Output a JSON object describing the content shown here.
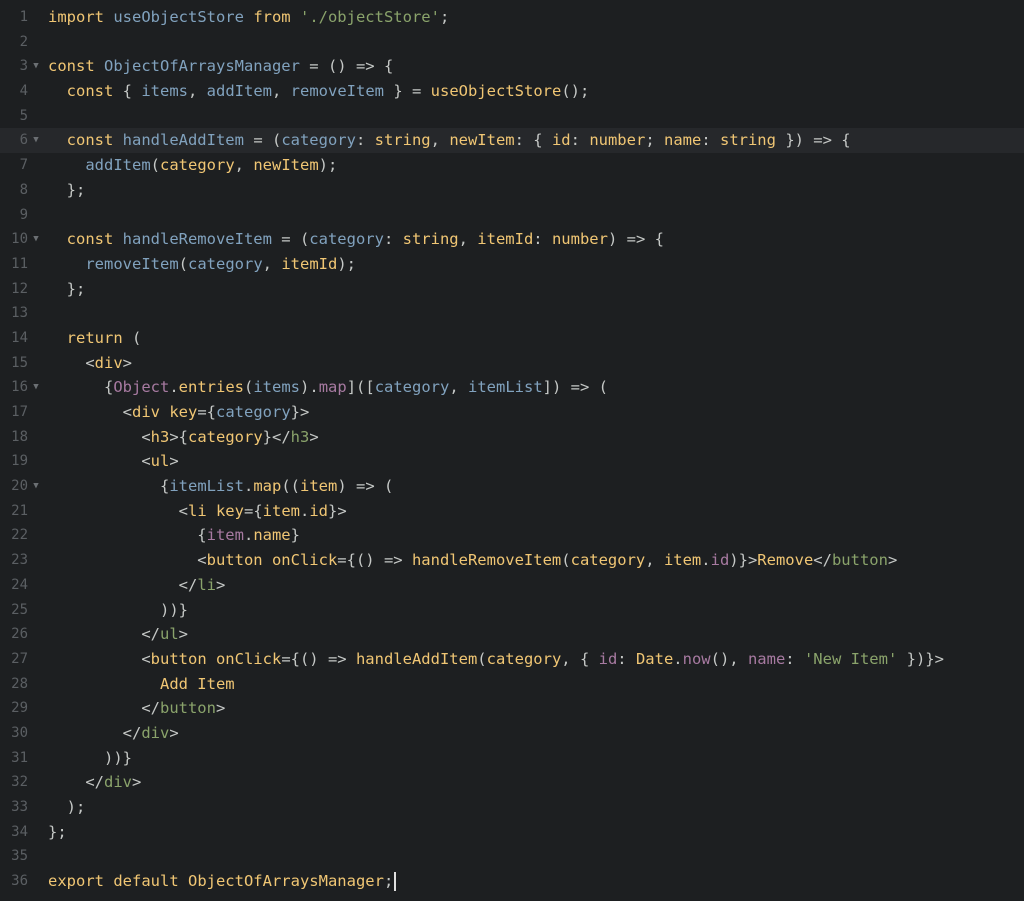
{
  "editor": {
    "lines": [
      {
        "n": "1",
        "fold": false,
        "t": [
          [
            "kw",
            "import "
          ],
          [
            "fn",
            "useObjectStore"
          ],
          [
            "kw",
            " from "
          ],
          [
            "gr",
            "'./objectStore'"
          ],
          [
            "wh",
            ";"
          ]
        ]
      },
      {
        "n": "2",
        "fold": false,
        "t": []
      },
      {
        "n": "3",
        "fold": true,
        "t": [
          [
            "kw",
            "const "
          ],
          [
            "fn",
            "ObjectOfArraysManager"
          ],
          [
            "wh",
            " = () => {"
          ]
        ]
      },
      {
        "n": "4",
        "fold": false,
        "t": [
          [
            "kw",
            "  const "
          ],
          [
            "wh",
            "{ "
          ],
          [
            "fn",
            "items"
          ],
          [
            "wh",
            ", "
          ],
          [
            "fn",
            "addItem"
          ],
          [
            "wh",
            ", "
          ],
          [
            "fn",
            "removeItem"
          ],
          [
            "wh",
            " } = "
          ],
          [
            "kw",
            "useObjectStore"
          ],
          [
            "wh",
            "();"
          ]
        ]
      },
      {
        "n": "5",
        "fold": false,
        "t": []
      },
      {
        "n": "6",
        "fold": true,
        "active": true,
        "t": [
          [
            "kw",
            "  const "
          ],
          [
            "fn",
            "handleAddItem"
          ],
          [
            "wh",
            " = ("
          ],
          [
            "fn",
            "category"
          ],
          [
            "wh",
            ": "
          ],
          [
            "kw",
            "string"
          ],
          [
            "wh",
            ", "
          ],
          [
            "kw",
            "newItem"
          ],
          [
            "wh",
            ": { "
          ],
          [
            "kw",
            "id"
          ],
          [
            "wh",
            ": "
          ],
          [
            "kw",
            "number"
          ],
          [
            "wh",
            "; "
          ],
          [
            "kw",
            "name"
          ],
          [
            "wh",
            ": "
          ],
          [
            "kw",
            "string"
          ],
          [
            "wh",
            " }) => {"
          ]
        ]
      },
      {
        "n": "7",
        "fold": false,
        "t": [
          [
            "fn",
            "    addItem"
          ],
          [
            "wh",
            "("
          ],
          [
            "kw",
            "category"
          ],
          [
            "wh",
            ", "
          ],
          [
            "kw",
            "newItem"
          ],
          [
            "wh",
            ");"
          ]
        ]
      },
      {
        "n": "8",
        "fold": false,
        "t": [
          [
            "wh",
            "  };"
          ]
        ]
      },
      {
        "n": "9",
        "fold": false,
        "t": []
      },
      {
        "n": "10",
        "fold": true,
        "t": [
          [
            "kw",
            "  const "
          ],
          [
            "fn",
            "handleRemoveItem"
          ],
          [
            "wh",
            " = ("
          ],
          [
            "fn",
            "category"
          ],
          [
            "wh",
            ": "
          ],
          [
            "kw",
            "string"
          ],
          [
            "wh",
            ", "
          ],
          [
            "kw",
            "itemId"
          ],
          [
            "wh",
            ": "
          ],
          [
            "kw",
            "number"
          ],
          [
            "wh",
            ") => {"
          ]
        ]
      },
      {
        "n": "11",
        "fold": false,
        "t": [
          [
            "fn",
            "    removeItem"
          ],
          [
            "wh",
            "("
          ],
          [
            "fn",
            "category"
          ],
          [
            "wh",
            ", "
          ],
          [
            "kw",
            "itemId"
          ],
          [
            "wh",
            ");"
          ]
        ]
      },
      {
        "n": "12",
        "fold": false,
        "t": [
          [
            "wh",
            "  };"
          ]
        ]
      },
      {
        "n": "13",
        "fold": false,
        "t": []
      },
      {
        "n": "14",
        "fold": false,
        "t": [
          [
            "kw",
            "  return "
          ],
          [
            "wh",
            "("
          ]
        ]
      },
      {
        "n": "15",
        "fold": false,
        "t": [
          [
            "wh",
            "    <"
          ],
          [
            "kw",
            "div"
          ],
          [
            "wh",
            ">"
          ]
        ]
      },
      {
        "n": "16",
        "fold": true,
        "t": [
          [
            "wh",
            "      {"
          ],
          [
            "pu",
            "Object"
          ],
          [
            "wh",
            "."
          ],
          [
            "kw",
            "entries"
          ],
          [
            "wh",
            "("
          ],
          [
            "fn",
            "items"
          ],
          [
            "wh",
            ")."
          ],
          [
            "pu",
            "map"
          ],
          [
            "wh",
            "](["
          ],
          [
            "fn",
            "category"
          ],
          [
            "wh",
            ", "
          ],
          [
            "fn",
            "itemList"
          ],
          [
            "wh",
            "]) => ("
          ]
        ]
      },
      {
        "n": "17",
        "fold": false,
        "t": [
          [
            "wh",
            "        <"
          ],
          [
            "kw",
            "div key"
          ],
          [
            "wh",
            "={"
          ],
          [
            "fn",
            "category"
          ],
          [
            "wh",
            "}>"
          ]
        ]
      },
      {
        "n": "18",
        "fold": false,
        "t": [
          [
            "wh",
            "          <"
          ],
          [
            "kw",
            "h3"
          ],
          [
            "wh",
            ">{"
          ],
          [
            "kw",
            "category"
          ],
          [
            "wh",
            "}</"
          ],
          [
            "gr",
            "h3"
          ],
          [
            "wh",
            ">"
          ]
        ]
      },
      {
        "n": "19",
        "fold": false,
        "t": [
          [
            "wh",
            "          <"
          ],
          [
            "kw",
            "ul"
          ],
          [
            "wh",
            ">"
          ]
        ]
      },
      {
        "n": "20",
        "fold": true,
        "t": [
          [
            "wh",
            "            {"
          ],
          [
            "fn",
            "itemList"
          ],
          [
            "wh",
            "."
          ],
          [
            "kw",
            "map"
          ],
          [
            "wh",
            "(("
          ],
          [
            "kw",
            "item"
          ],
          [
            "wh",
            ") => ("
          ]
        ]
      },
      {
        "n": "21",
        "fold": false,
        "t": [
          [
            "wh",
            "              <"
          ],
          [
            "kw",
            "li key"
          ],
          [
            "wh",
            "={"
          ],
          [
            "kw",
            "item"
          ],
          [
            "wh",
            "."
          ],
          [
            "kw",
            "id"
          ],
          [
            "wh",
            "}>"
          ]
        ]
      },
      {
        "n": "22",
        "fold": false,
        "t": [
          [
            "wh",
            "                {"
          ],
          [
            "pu",
            "item"
          ],
          [
            "wh",
            "."
          ],
          [
            "kw",
            "name"
          ],
          [
            "wh",
            "}"
          ]
        ]
      },
      {
        "n": "23",
        "fold": false,
        "t": [
          [
            "wh",
            "                <"
          ],
          [
            "kw",
            "button onClick"
          ],
          [
            "wh",
            "={() => "
          ],
          [
            "kw",
            "handleRemoveItem"
          ],
          [
            "wh",
            "("
          ],
          [
            "kw",
            "category"
          ],
          [
            "wh",
            ", "
          ],
          [
            "kw",
            "item"
          ],
          [
            "wh",
            "."
          ],
          [
            "pu",
            "id"
          ],
          [
            "wh",
            ")}>"
          ],
          [
            "kw",
            "Remove"
          ],
          [
            "wh",
            "</"
          ],
          [
            "gr",
            "button"
          ],
          [
            "wh",
            ">"
          ]
        ]
      },
      {
        "n": "24",
        "fold": false,
        "t": [
          [
            "wh",
            "              </"
          ],
          [
            "gr",
            "li"
          ],
          [
            "wh",
            ">"
          ]
        ]
      },
      {
        "n": "25",
        "fold": false,
        "t": [
          [
            "wh",
            "            ))}"
          ]
        ]
      },
      {
        "n": "26",
        "fold": false,
        "t": [
          [
            "wh",
            "          </"
          ],
          [
            "gr",
            "ul"
          ],
          [
            "wh",
            ">"
          ]
        ]
      },
      {
        "n": "27",
        "fold": false,
        "t": [
          [
            "wh",
            "          <"
          ],
          [
            "kw",
            "button onClick"
          ],
          [
            "wh",
            "={() => "
          ],
          [
            "kw",
            "handleAddItem"
          ],
          [
            "wh",
            "("
          ],
          [
            "kw",
            "category"
          ],
          [
            "wh",
            ", { "
          ],
          [
            "pu",
            "id"
          ],
          [
            "wh",
            ": "
          ],
          [
            "kw",
            "Date"
          ],
          [
            "wh",
            "."
          ],
          [
            "pu",
            "now"
          ],
          [
            "wh",
            "(), "
          ],
          [
            "pu",
            "name"
          ],
          [
            "wh",
            ": "
          ],
          [
            "gr",
            "'New Item'"
          ],
          [
            "wh",
            " })}>"
          ]
        ]
      },
      {
        "n": "28",
        "fold": false,
        "t": [
          [
            "kw",
            "            Add Item"
          ]
        ]
      },
      {
        "n": "29",
        "fold": false,
        "t": [
          [
            "wh",
            "          </"
          ],
          [
            "gr",
            "button"
          ],
          [
            "wh",
            ">"
          ]
        ]
      },
      {
        "n": "30",
        "fold": false,
        "t": [
          [
            "wh",
            "        </"
          ],
          [
            "gr",
            "div"
          ],
          [
            "wh",
            ">"
          ]
        ]
      },
      {
        "n": "31",
        "fold": false,
        "t": [
          [
            "wh",
            "      ))}"
          ]
        ]
      },
      {
        "n": "32",
        "fold": false,
        "t": [
          [
            "wh",
            "    </"
          ],
          [
            "gr",
            "div"
          ],
          [
            "wh",
            ">"
          ]
        ]
      },
      {
        "n": "33",
        "fold": false,
        "t": [
          [
            "wh",
            "  );"
          ]
        ]
      },
      {
        "n": "34",
        "fold": false,
        "t": [
          [
            "wh",
            "};"
          ]
        ]
      },
      {
        "n": "35",
        "fold": false,
        "t": []
      },
      {
        "n": "36",
        "fold": false,
        "cursor": true,
        "t": [
          [
            "kw",
            "export default "
          ],
          [
            "kw",
            "ObjectOfArraysManager"
          ],
          [
            "wh",
            ";"
          ]
        ]
      }
    ],
    "fold_glyph": "▼"
  },
  "colors": {
    "background": "#1d1f21",
    "keyword": "#f0c674",
    "identifier": "#81a2be",
    "string": "#8aa36b",
    "purple": "#a77aa1",
    "text": "#c5c8c6",
    "line_number": "#5b5f63"
  }
}
